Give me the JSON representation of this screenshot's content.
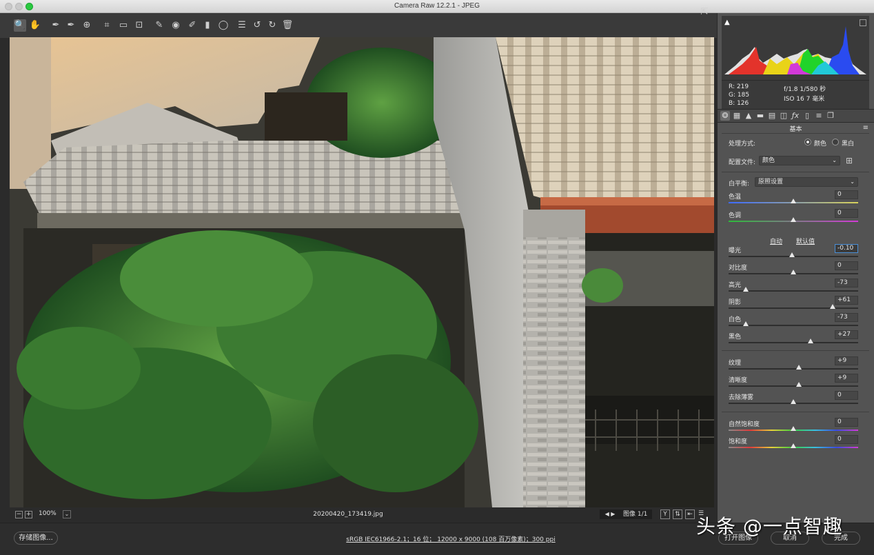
{
  "window": {
    "title": "Camera Raw 12.2.1 -  JPEG"
  },
  "toolbar": {
    "tools": [
      {
        "name": "zoom-tool",
        "glyph": "🔍"
      },
      {
        "name": "hand-tool",
        "glyph": "✋"
      },
      {
        "name": "white-balance-tool",
        "glyph": "✒"
      },
      {
        "name": "color-sampler-tool",
        "glyph": "✒"
      },
      {
        "name": "targeted-adjustment-tool",
        "glyph": "⊕"
      },
      {
        "name": "crop-tool",
        "glyph": "⌗"
      },
      {
        "name": "straighten-tool",
        "glyph": "▭"
      },
      {
        "name": "transform-tool",
        "glyph": "⊡"
      },
      {
        "name": "spot-removal-tool",
        "glyph": "✎"
      },
      {
        "name": "red-eye-tool",
        "glyph": "◉"
      },
      {
        "name": "adjustment-brush-tool",
        "glyph": "✐"
      },
      {
        "name": "graduated-filter-tool",
        "glyph": "▮"
      },
      {
        "name": "radial-filter-tool",
        "glyph": "◯"
      },
      {
        "name": "preferences-tool",
        "glyph": "☰"
      },
      {
        "name": "rotate-left-tool",
        "glyph": "↺"
      },
      {
        "name": "rotate-right-tool",
        "glyph": "↻"
      },
      {
        "name": "trash-tool",
        "glyph": "🗑"
      }
    ]
  },
  "viewer": {
    "zoom": "100%",
    "zoom_out": "−",
    "zoom_in": "+",
    "filename": "20200420_173419.jpg",
    "image_count": "图像 1/1",
    "nav": "◀ ▶"
  },
  "histogram_readout": {
    "r": "R:   219",
    "g": "G:   185",
    "b": "B:   126",
    "aperture_shutter": "f/1.8    1/580 秒",
    "iso_focal": "ISO 16    7 毫米"
  },
  "panel": {
    "section_title": "基本",
    "treatment_label": "处理方式:",
    "treatment_color": "颜色",
    "treatment_bw": "黑白",
    "profile_label": "配置文件:",
    "profile_value": "颜色",
    "wb_label": "白平衡:",
    "wb_value": "原照设置",
    "auto": "自动",
    "default": "默认值",
    "sliders": [
      {
        "label": "色温",
        "value": "0",
        "pos": 0.5
      },
      {
        "label": "色调",
        "value": "0",
        "pos": 0.5
      },
      {
        "label": "曝光",
        "value": "-0.10",
        "pos": 0.49
      },
      {
        "label": "对比度",
        "value": "0",
        "pos": 0.5
      },
      {
        "label": "高光",
        "value": "-73",
        "pos": 0.135
      },
      {
        "label": "阴影",
        "value": "+61",
        "pos": 0.805
      },
      {
        "label": "白色",
        "value": "-73",
        "pos": 0.135
      },
      {
        "label": "黑色",
        "value": "+27",
        "pos": 0.635
      },
      {
        "label": "纹理",
        "value": "+9",
        "pos": 0.545
      },
      {
        "label": "清晰度",
        "value": "+9",
        "pos": 0.545
      },
      {
        "label": "去除薄雾",
        "value": "0",
        "pos": 0.5
      },
      {
        "label": "自然饱和度",
        "value": "0",
        "pos": 0.5
      },
      {
        "label": "饱和度",
        "value": "0",
        "pos": 0.5
      }
    ]
  },
  "bottom": {
    "save": "存储图像...",
    "workflow": "sRGB IEC61966-2.1；16 位；  12000 x 9000 (108 百万像素)；300 ppi",
    "open": "打开图像",
    "cancel": "取消",
    "done": "完成"
  },
  "watermark": "头条 @一点智趣",
  "colors": {
    "accent": "#4a90d9",
    "panel_bg": "#535353",
    "toolbar_bg": "#3a3a3a"
  }
}
